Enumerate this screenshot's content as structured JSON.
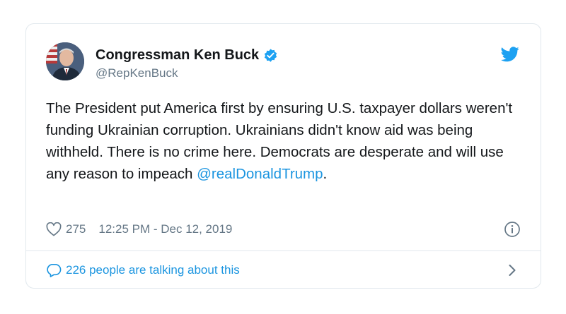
{
  "tweet": {
    "author": {
      "display_name": "Congressman Ken Buck",
      "handle": "@RepKenBuck",
      "verified_icon": "verified-badge-icon"
    },
    "text": "The President put America first by ensuring U.S. taxpayer dollars weren't funding Ukrainian corruption. Ukrainians didn't know aid was being withheld. There is no crime here. Democrats are desperate and will use any reason to impeach ",
    "mention": "@realDonaldTrump",
    "trailing": ".",
    "likes": "275",
    "timestamp": "12:25 PM - Dec 12, 2019",
    "conversation": "226 people are talking about this"
  },
  "colors": {
    "accent": "#1b95e0",
    "secondary_text": "#657786",
    "border": "#e1e8ed"
  },
  "icons": {
    "brand": "twitter-bird-icon",
    "like": "heart-icon",
    "info": "info-icon",
    "reply": "speech-bubble-icon",
    "more": "chevron-right-icon"
  }
}
